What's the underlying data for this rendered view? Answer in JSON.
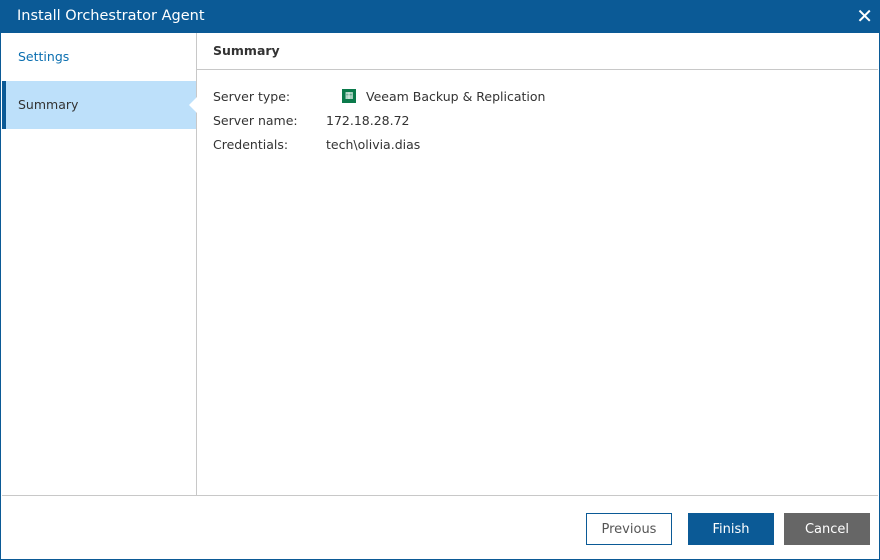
{
  "title": "Install Orchestrator Agent",
  "steps": [
    {
      "label": "Settings"
    },
    {
      "label": "Summary"
    }
  ],
  "summary": {
    "heading": "Summary",
    "rows": [
      {
        "label": "Server type:",
        "value": "Veeam Backup & Replication"
      },
      {
        "label": "Server name:",
        "value": "172.18.28.72"
      },
      {
        "label": "Credentials:",
        "value": "tech\\olivia.dias"
      }
    ]
  },
  "buttons": {
    "previous": "Previous",
    "finish": "Finish",
    "cancel": "Cancel"
  }
}
